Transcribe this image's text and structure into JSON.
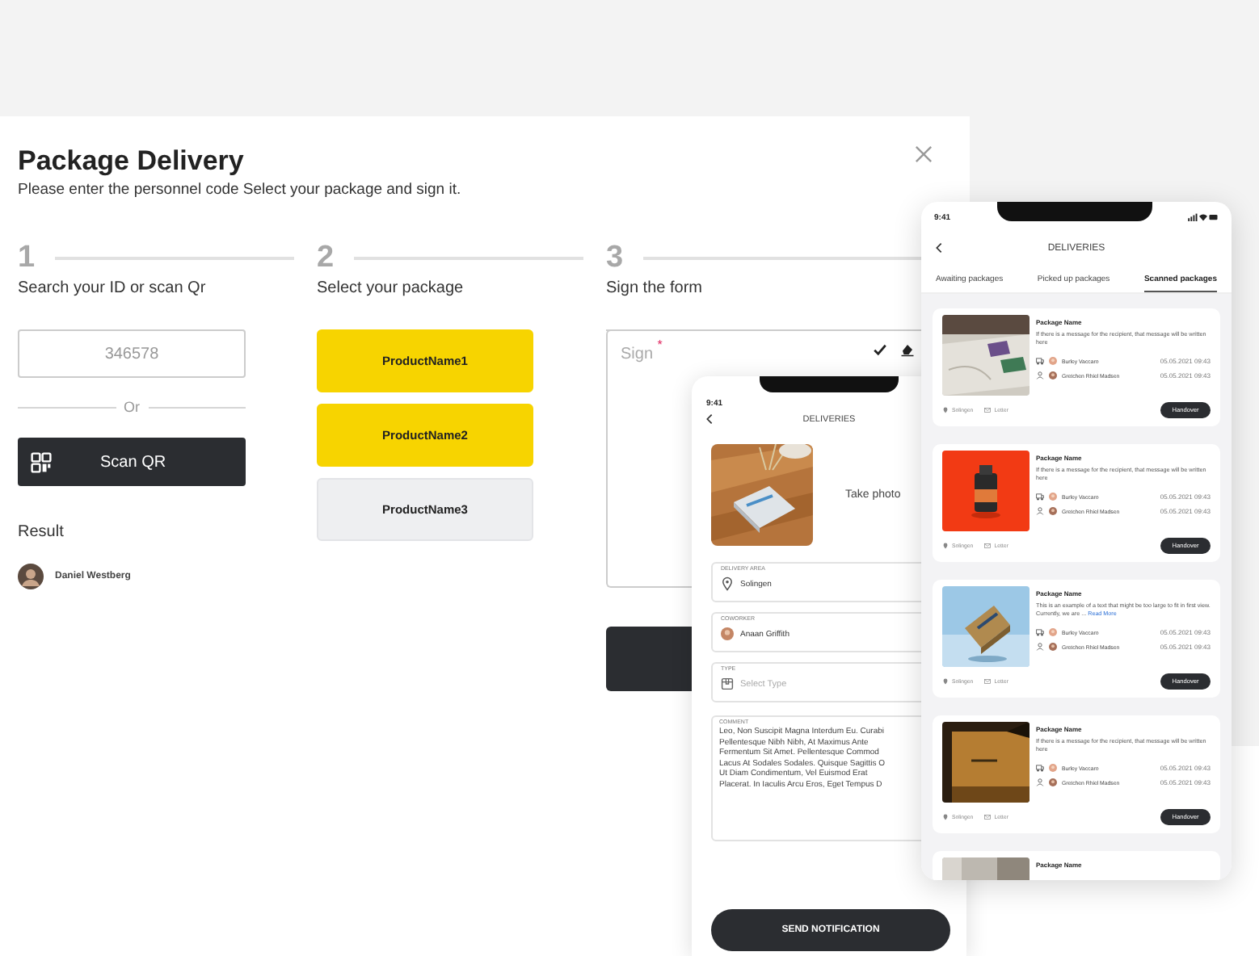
{
  "modal": {
    "title": "Package Delivery",
    "subtitle": "Please enter the personnel code Select your package and sign it."
  },
  "steps": [
    {
      "number": "1",
      "label": "Search your ID or scan Qr"
    },
    {
      "number": "2",
      "label": "Select your package"
    },
    {
      "number": "3",
      "label": "Sign the form"
    }
  ],
  "search": {
    "placeholder": "346578",
    "divider": "Or",
    "scan_button": "Scan QR",
    "result_label": "Result",
    "result_name": "Daniel Westberg"
  },
  "products": [
    {
      "label": "ProductName1",
      "selected": true
    },
    {
      "label": "ProductName2",
      "selected": true
    },
    {
      "label": "ProductName3",
      "selected": false
    }
  ],
  "sign": {
    "label": "Sign",
    "required_mark": "*"
  },
  "form_phone": {
    "time": "9:41",
    "title": "DELIVERIES",
    "photo_label": "Take photo",
    "fields": [
      {
        "kind": "location",
        "label": "DELIVERY AREA",
        "value": "Solingen"
      },
      {
        "kind": "person",
        "label": "COWORKER",
        "value": "Anaan Griffith"
      },
      {
        "kind": "select",
        "label": "TYPE",
        "placeholder": "Select Type"
      }
    ],
    "comment": {
      "label": "COMMENT",
      "lines": [
        "Leo, Non Suscipit Magna Interdum Eu. Curabi",
        "Pellentesque Nibh Nibh, At Maximus Ante",
        "Fermentum Sit Amet. Pellentesque Commod",
        "Lacus At Sodales Sodales. Quisque Sagittis O",
        "Ut Diam Condimentum, Vel Euismod Erat",
        "Placerat. In Iaculis Arcu Eros, Eget Tempus D"
      ]
    },
    "button": "SEND NOTIFICATION"
  },
  "list_phone": {
    "time": "9:41",
    "title": "DELIVERIES",
    "tabs": [
      {
        "label": "Awaiting packages",
        "selected": false
      },
      {
        "label": "Picked up packages",
        "selected": false
      },
      {
        "label": "Scanned packages",
        "selected": true
      }
    ],
    "cards": [
      {
        "kind": "full",
        "name": "Package Name",
        "message": "If there is a message for the recipient, that message will be written here",
        "sender": "Burley Vaccaro",
        "sender_date": "05.05.2021 09:43",
        "receiver": "Gretchen Rhiel Madsen",
        "receiver_date": "05.05.2021 09:43",
        "tags": [
          "Solingen",
          "Letter"
        ],
        "button": "Handover"
      },
      {
        "kind": "full",
        "name": "Package Name",
        "message": "If there is a message for the recipient, that message will be written here",
        "sender": "Burley Vaccaro",
        "sender_date": "05.05.2021 09:43",
        "receiver": "Gretchen Rhiel Madsen",
        "receiver_date": "05.05.2021 09:43",
        "tags": [
          "Solingen",
          "Letter"
        ],
        "button": "Handover"
      },
      {
        "kind": "full",
        "name": "Package Name",
        "message": "This is an example of a text that might be too large to fit in first view. Currently, we are ...",
        "link": "Read More",
        "sender": "Burley Vaccaro",
        "sender_date": "05.05.2021 09:43",
        "receiver": "Gretchen Rhiel Madsen",
        "receiver_date": "05.05.2021 09:43",
        "tags": [
          "Solingen",
          "Letter"
        ],
        "button": "Handover"
      },
      {
        "kind": "full",
        "name": "Package Name",
        "message": "If there is a message for the recipient, that message will be written here",
        "sender": "Burley Vaccaro",
        "sender_date": "05.05.2021 09:43",
        "receiver": "Gretchen Rhiel Madsen",
        "receiver_date": "05.05.2021 09:43",
        "tags": [
          "Solingen",
          "Letter"
        ],
        "button": "Handover"
      },
      {
        "kind": "partial",
        "name": "Package Name"
      }
    ]
  }
}
